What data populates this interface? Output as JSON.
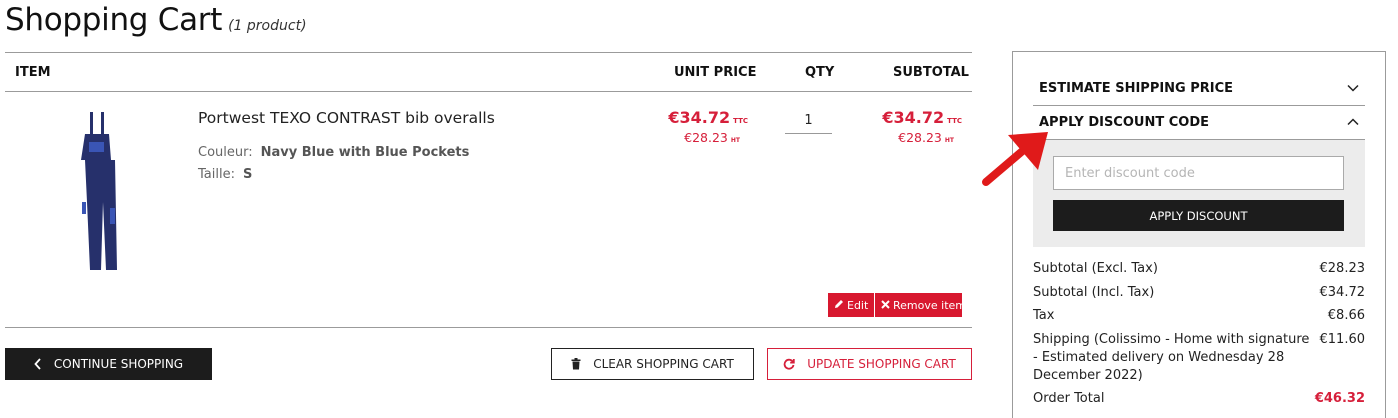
{
  "page": {
    "title": "Shopping Cart",
    "count": "(1 product)"
  },
  "table": {
    "headers": {
      "item": "ITEM",
      "unit_price": "UNIT PRICE",
      "qty": "QTY",
      "subtotal": "SUBTOTAL"
    }
  },
  "item": {
    "name": "Portwest TEXO CONTRAST bib overalls",
    "attributes": [
      {
        "label": "Couleur:",
        "value": "Navy Blue with Blue Pockets"
      },
      {
        "label": "Taille:",
        "value": "S"
      }
    ],
    "unit_price_incl": "€34.72",
    "unit_price_excl": "€28.23",
    "qty": "1",
    "subtotal_incl": "€34.72",
    "subtotal_excl": "€28.23",
    "suffix_incl": "TTC",
    "suffix_excl": "HT",
    "edit_label": "Edit",
    "remove_label": "Remove item"
  },
  "actions": {
    "continue": "CONTINUE SHOPPING",
    "clear": "CLEAR SHOPPING CART",
    "update": "UPDATE SHOPPING CART"
  },
  "sidebar": {
    "estimate_shipping": "ESTIMATE SHIPPING PRICE",
    "apply_discount_header": "APPLY DISCOUNT CODE",
    "discount_placeholder": "Enter discount code",
    "discount_value": "",
    "apply_discount_button": "APPLY DISCOUNT",
    "totals": [
      {
        "label": "Subtotal (Excl. Tax)",
        "value": "€28.23"
      },
      {
        "label": "Subtotal (Incl. Tax)",
        "value": "€34.72"
      },
      {
        "label": "Tax",
        "value": "€8.66"
      },
      {
        "label": "Shipping (Colissimo - Home with signature - Estimated delivery on Wednesday 28 December 2022)",
        "value": "€11.60"
      },
      {
        "label": "Order Total",
        "value": "€46.32"
      }
    ]
  },
  "colors": {
    "accent_red": "#d61f3a",
    "dark_button": "#1c1c1c",
    "navy_product": "#26306b",
    "annotation_arrow": "#e01a1a"
  },
  "icons": {
    "chevron_down": "chevron-down-icon",
    "chevron_up": "chevron-up-icon",
    "chevron_left": "chevron-left-icon",
    "trash": "trash-icon",
    "refresh": "refresh-icon",
    "pencil": "pencil-icon",
    "close": "close-icon"
  }
}
